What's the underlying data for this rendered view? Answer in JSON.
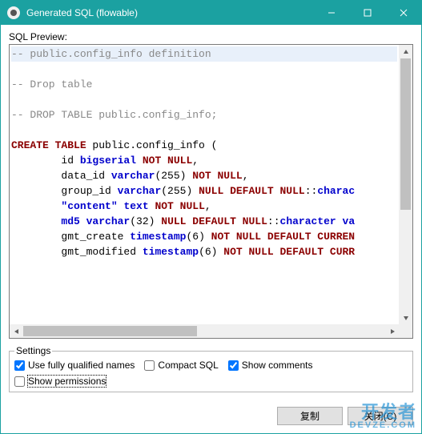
{
  "window": {
    "title": "Generated SQL (flowable)"
  },
  "labels": {
    "sql_preview": "SQL Preview:",
    "settings_legend": "Settings"
  },
  "sql": {
    "l1": "-- public.config_info definition",
    "l2": "",
    "l3": "-- Drop table",
    "l4": "",
    "l5": "-- DROP TABLE public.config_info;",
    "l6": "",
    "l7a": "CREATE TABLE",
    "l7b": " public.config_info (",
    "l8a": "\tid ",
    "l8b": "bigserial",
    "l8c": " NOT NULL",
    "l8d": ",",
    "l9a": "\tdata_id ",
    "l9b": "varchar",
    "l9c": "(255)",
    "l9d": " NOT NULL",
    "l9e": ",",
    "l10a": "\tgroup_id ",
    "l10b": "varchar",
    "l10c": "(255)",
    "l10d": " NULL DEFAULT NULL",
    "l10e": "::",
    "l10f": "charac",
    "l11a": "\t",
    "l11b": "\"content\"",
    "l11c": " text",
    "l11d": " NOT NULL",
    "l11e": ",",
    "l12a": "\t",
    "l12b": "md5",
    "l12c": " varchar",
    "l12d": "(32)",
    "l12e": " NULL DEFAULT NULL",
    "l12f": "::",
    "l12g": "character va",
    "l13a": "\tgmt_create ",
    "l13b": "timestamp",
    "l13c": "(6)",
    "l13d": " NOT NULL DEFAULT CURREN",
    "l14a": "\tgmt_modified ",
    "l14b": "timestamp",
    "l14c": "(6)",
    "l14d": " NOT NULL DEFAULT CURR"
  },
  "settings": {
    "use_fqn": {
      "label": "Use fully qualified names",
      "checked": true
    },
    "compact_sql": {
      "label": "Compact SQL",
      "checked": false
    },
    "show_comments": {
      "label": "Show comments",
      "checked": true
    },
    "show_permissions": {
      "label": "Show permissions",
      "checked": false
    }
  },
  "buttons": {
    "copy": "复制",
    "close": "关闭(C)"
  },
  "watermark": {
    "main": "开发者",
    "sub": "DEVZE.COM"
  }
}
